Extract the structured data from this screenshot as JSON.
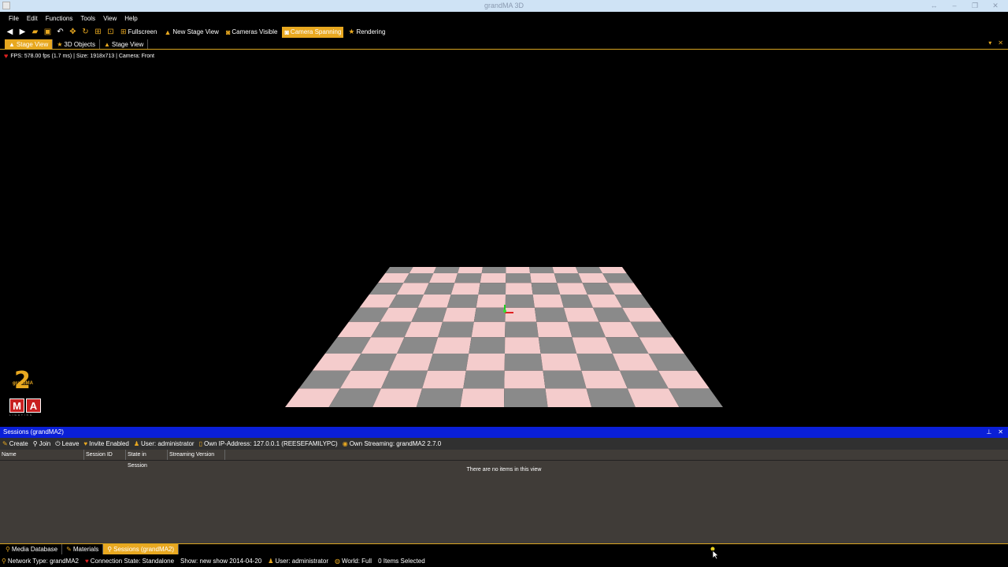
{
  "window": {
    "title": "grandMA 3D",
    "controls": [
      "↔",
      "–",
      "❐",
      "✕"
    ]
  },
  "menu": [
    "File",
    "Edit",
    "Functions",
    "Tools",
    "View",
    "Help"
  ],
  "toolbar": {
    "fullscreen": "Fullscreen",
    "new_stage_view": "New Stage View",
    "cameras_visible": "Cameras Visible",
    "camera_spanning": "Camera Spanning",
    "rendering": "Rendering"
  },
  "view_tabs": [
    "Stage View",
    "3D Objects",
    "Stage View"
  ],
  "fps_text": "FPS: 578.00 fps (1.7 ms) | Size: 1918x713 | Camera: Front",
  "logo": {
    "number": "2",
    "brand": "grandMA",
    "letters": [
      "M",
      "A"
    ],
    "sub": "LIGHTING"
  },
  "sessions": {
    "title": "Sessions (grandMA2)",
    "toolbar": {
      "create": "Create",
      "join": "Join",
      "leave": "Leave",
      "invite": "Invite Enabled",
      "user": "User: administrator",
      "ip": "Own IP-Address: 127.0.0.1 (REESEFAMILYPC)",
      "streaming": "Own Streaming: grandMA2 2.7.0"
    },
    "columns": [
      "Name",
      "Session ID",
      "State in Session",
      "Streaming Version"
    ],
    "empty_text": "There are no items in this view"
  },
  "bottom_tabs": [
    "Media Database",
    "Materials",
    "Sessions (grandMA2)"
  ],
  "status": {
    "network": "Network Type: grandMA2",
    "connection": "Connection State: Standalone",
    "show": "Show: new show 2014-04-20",
    "user": "User: administrator",
    "world": "World: Full",
    "selected": "0 Items Selected"
  },
  "colors": {
    "accent": "#e8a820",
    "session_header": "#0a1fd8",
    "floor_light": "#f4cccc",
    "floor_dark": "#8a8a8a"
  }
}
